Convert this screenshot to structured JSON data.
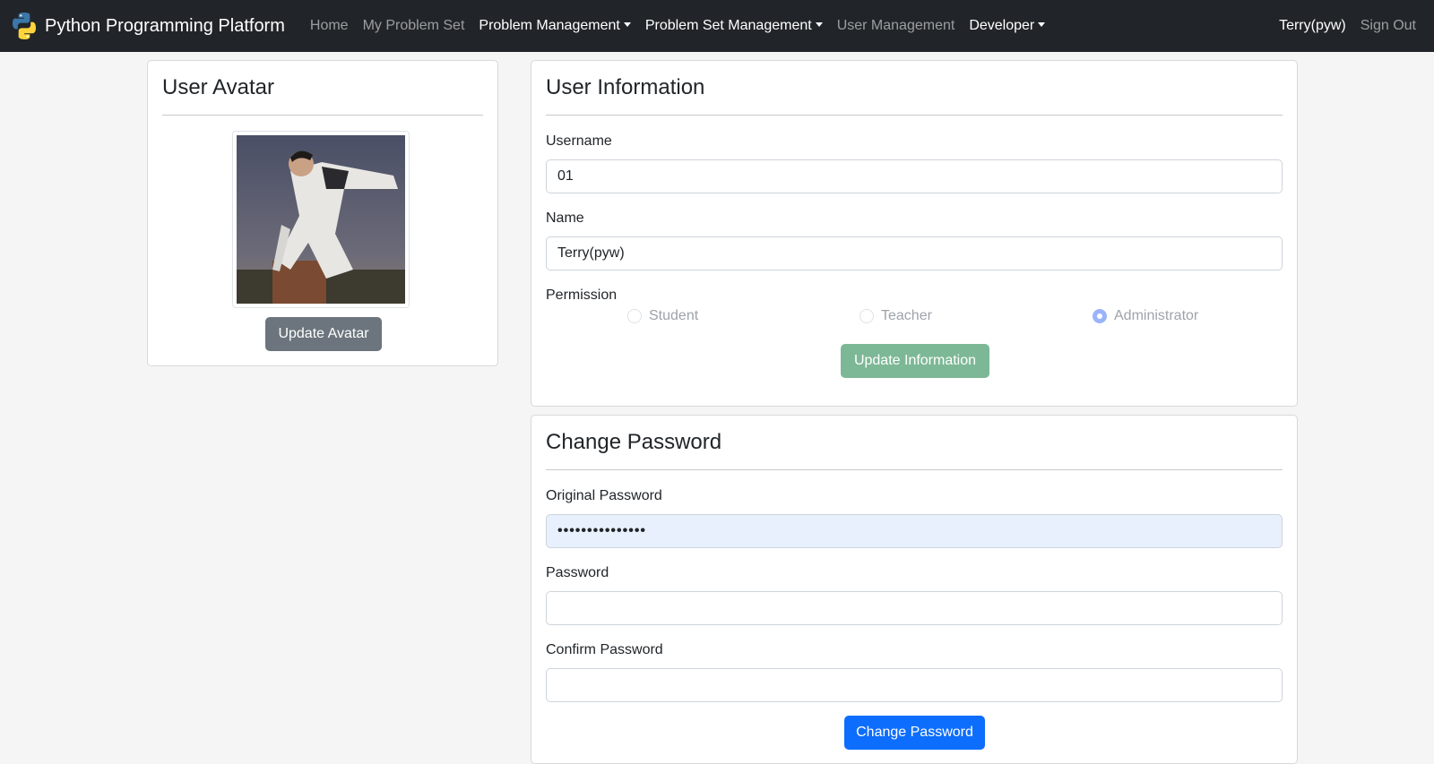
{
  "navbar": {
    "brand": "Python Programming Platform",
    "links": [
      {
        "label": "Home"
      },
      {
        "label": "My Problem Set"
      },
      {
        "label": "Problem Management"
      },
      {
        "label": "Problem Set Management"
      },
      {
        "label": "User Management"
      },
      {
        "label": "Developer"
      }
    ],
    "user": "Terry(pyw)",
    "sign_out": "Sign Out"
  },
  "avatar_card": {
    "title": "User Avatar",
    "update_button": "Update Avatar"
  },
  "info_card": {
    "title": "User Information",
    "username_label": "Username",
    "username_value": "01",
    "name_label": "Name",
    "name_value": "Terry(pyw)",
    "permission_label": "Permission",
    "permission_options": [
      {
        "label": "Student",
        "checked": false
      },
      {
        "label": "Teacher",
        "checked": false
      },
      {
        "label": "Administrator",
        "checked": true
      }
    ],
    "update_button": "Update Information"
  },
  "password_card": {
    "title": "Change Password",
    "original_label": "Original Password",
    "original_value": "•••••••••••••••",
    "password_label": "Password",
    "password_value": "",
    "confirm_label": "Confirm Password",
    "confirm_value": "",
    "change_button": "Change Password"
  },
  "colors": {
    "navbar_bg": "#212529",
    "primary": "#0d6efd",
    "secondary": "#6c757d",
    "success_disabled": "#7db896",
    "autofill_bg": "#e8f0fe"
  }
}
